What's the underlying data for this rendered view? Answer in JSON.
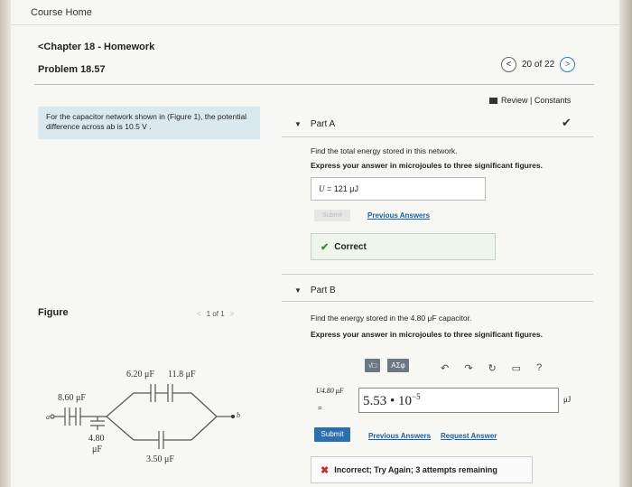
{
  "topbar": {
    "course_home": "Course Home"
  },
  "header": {
    "chapter": "<Chapter 18 - Homework",
    "problem": "Problem 18.57",
    "pager": {
      "prev": "<",
      "count": "20 of 22",
      "next": ">"
    }
  },
  "review": {
    "label": "Review | Constants"
  },
  "context": {
    "text": "For the capacitor network shown in (Figure 1), the potential difference across ab is 10.5 V ."
  },
  "part_a": {
    "title": "Part A",
    "question": "Find the total energy stored in this network.",
    "instruction": "Express your answer in microjoules to three significant figures.",
    "answer_var": "U",
    "answer_value": "= 121 μJ",
    "submit_label": "Submit",
    "previous_answers": "Previous Answers",
    "status": "Correct"
  },
  "figure": {
    "label": "Figure",
    "pager": "1 of 1",
    "prev": "<",
    "next": ">"
  },
  "circuit": {
    "labels": {
      "c620": "6.20 μF",
      "c118": "11.8 μF",
      "c860": "8.60 μF",
      "c480a": "4.80",
      "c480b": "μF",
      "c350": "3.50 μF",
      "a": "a",
      "b": "b"
    }
  },
  "part_b": {
    "title": "Part B",
    "question": "Find the energy stored in the 4.80 μF capacitor.",
    "instruction": "Express your answer in microjoules to three significant figures.",
    "toolbar": {
      "templates": "√□",
      "symbols": "AΣφ",
      "help": "?"
    },
    "answer_label": "U4.80 μF",
    "eq": "=",
    "answer_value": "5.53 • 10",
    "answer_exp": "−5",
    "unit": "μJ",
    "submit_label": "Submit",
    "previous_answers": "Previous Answers",
    "request_answer": "Request Answer",
    "status": "Incorrect; Try Again; 3 attempts remaining"
  },
  "colors": {
    "accent": "#2c6fae",
    "correct": "#3a8a33",
    "incorrect": "#c03030",
    "context_bg": "#d9e9ef"
  }
}
